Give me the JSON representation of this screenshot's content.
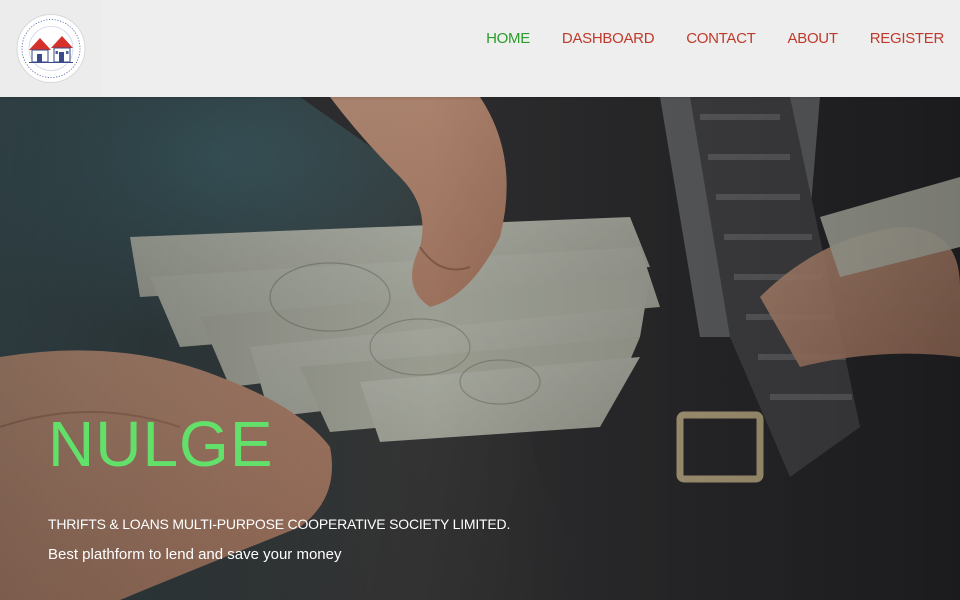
{
  "header": {
    "logo_icon": "cooperative-house-logo-icon",
    "nav": [
      {
        "label": "HOME",
        "active": true
      },
      {
        "label": "DASHBOARD",
        "active": false
      },
      {
        "label": "CONTACT",
        "active": false
      },
      {
        "label": "ABOUT",
        "active": false
      },
      {
        "label": "REGISTER",
        "active": false
      }
    ]
  },
  "hero": {
    "background_icon": "money-exchange-photo",
    "title": "NULGE",
    "subtitle": "THRIFTS & LOANS MULTI-PURPOSE COOPERATIVE SOCIETY LIMITED.",
    "tagline": "Best plathform to lend and save your money"
  },
  "colors": {
    "nav_active": "#2a9d2a",
    "nav_default": "#c03a2b",
    "title": "#62e06a",
    "header_bg": "#f4f4f4"
  }
}
